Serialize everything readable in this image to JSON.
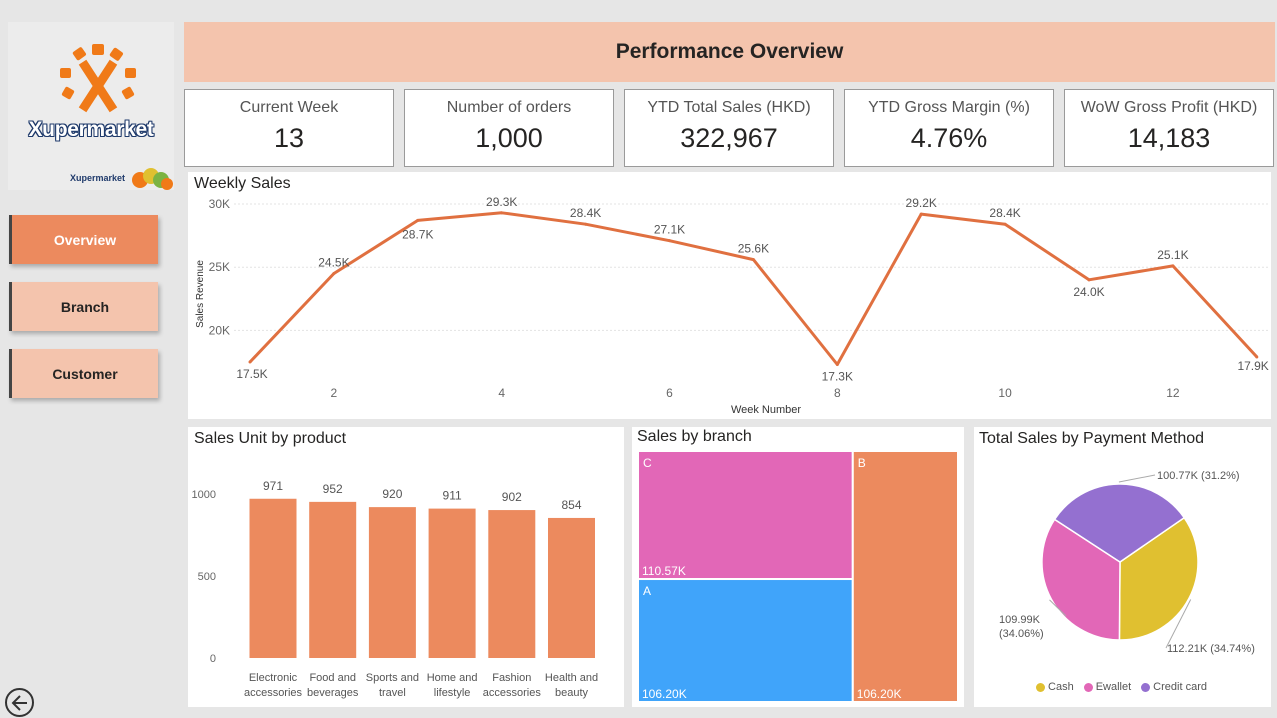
{
  "brand": {
    "name": "Xupermarket",
    "small_name": "Xupermarket"
  },
  "nav": {
    "overview": "Overview",
    "branch": "Branch",
    "customer": "Customer"
  },
  "header": {
    "title": "Performance Overview"
  },
  "kpis": [
    {
      "label": "Current Week",
      "value": "13"
    },
    {
      "label": "Number of orders",
      "value": "1,000"
    },
    {
      "label": "YTD Total Sales (HKD)",
      "value": "322,967"
    },
    {
      "label": "YTD Gross Margin (%)",
      "value": "4.76%"
    },
    {
      "label": "WoW Gross Profit (HKD)",
      "value": "14,183"
    }
  ],
  "colors": {
    "accent": "#ec8a5e",
    "header": "#f4c4ad",
    "line": "#e07040",
    "branch_c": "#e267b7",
    "branch_a": "#40a4fa",
    "branch_b": "#ec8a5e",
    "cash": "#e0c030",
    "ewallet": "#e267b7",
    "credit_card": "#9470d0"
  },
  "chart_data": [
    {
      "type": "line",
      "title": "Weekly Sales",
      "xlabel": "Week Number",
      "ylabel": "Sales Revenue",
      "x": [
        1,
        2,
        3,
        4,
        5,
        6,
        7,
        8,
        9,
        10,
        11,
        12,
        13
      ],
      "values": [
        17500,
        24500,
        28700,
        29300,
        28400,
        27100,
        25600,
        17300,
        29200,
        28400,
        24000,
        25100,
        17900
      ],
      "data_labels": [
        "17.5K",
        "24.5K",
        "28.7K",
        "29.3K",
        "28.4K",
        "27.1K",
        "25.6K",
        "17.3K",
        "29.2K",
        "28.4K",
        "24.0K",
        "25.1K",
        "17.9K"
      ],
      "x_ticks": [
        "2",
        "4",
        "6",
        "8",
        "10",
        "12"
      ],
      "y_ticks": [
        "20K",
        "25K",
        "30K"
      ],
      "ylim": [
        16500,
        30000
      ],
      "grid": true
    },
    {
      "type": "bar",
      "title": "Sales Unit by product",
      "categories": [
        [
          "Electronic",
          "accessories"
        ],
        [
          "Food and",
          "beverages"
        ],
        [
          "Sports and",
          "travel"
        ],
        [
          "Home and",
          "lifestyle"
        ],
        [
          "Fashion",
          "accessories"
        ],
        [
          "Health and",
          "beauty"
        ]
      ],
      "values": [
        971,
        952,
        920,
        911,
        902,
        854
      ],
      "y_ticks": [
        "0",
        "500",
        "1000"
      ],
      "ylim": [
        0,
        1200
      ]
    },
    {
      "type": "treemap",
      "title": "Sales by branch",
      "items": [
        {
          "name": "C",
          "value": 110570,
          "label": "110.57K"
        },
        {
          "name": "A",
          "value": 106200,
          "label": "106.20K"
        },
        {
          "name": "B",
          "value": 106200,
          "label": "106.20K"
        }
      ]
    },
    {
      "type": "pie",
      "title": "Total Sales by Payment Method",
      "slices": [
        {
          "name": "Cash",
          "value": 112210,
          "label": [
            "112.21K (34.74%)"
          ]
        },
        {
          "name": "Ewallet",
          "value": 109990,
          "label": [
            "109.99K",
            "(34.06%)"
          ]
        },
        {
          "name": "Credit card",
          "value": 100770,
          "label": [
            "100.77K (31.2%)"
          ]
        }
      ],
      "legend": "bottom"
    }
  ]
}
